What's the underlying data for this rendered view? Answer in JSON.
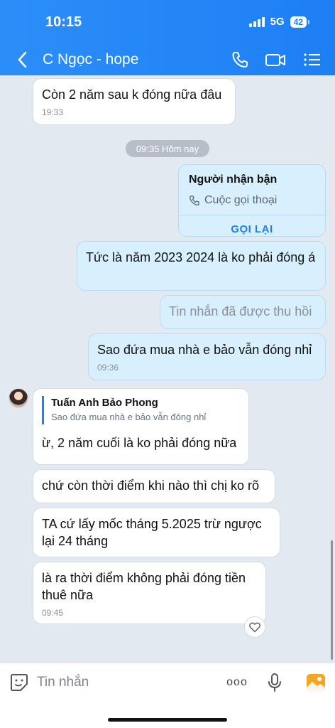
{
  "status_bar": {
    "time": "10:15",
    "network": "5G",
    "battery": "42"
  },
  "header": {
    "title": "C Ngọc - hope"
  },
  "messages": {
    "m1": {
      "text": "Còn 2 năm sau k đóng nữa đâu",
      "time": "19:33"
    },
    "date_separator": "09:35 Hôm nay",
    "call": {
      "who": "Người nhận bận",
      "type": "Cuộc gọi thoại",
      "action": "GỌI LẠI"
    },
    "m2": {
      "text": "Tức là năm 2023 2024 là ko phải đóng á"
    },
    "m3": {
      "text": "Tin nhắn đã được thu hồi"
    },
    "m4": {
      "text": "Sao đứa mua nhà e bảo vẫn đóng nhỉ",
      "time": "09:36"
    },
    "m5": {
      "quote_name": "Tuấn Anh Bảo Phong",
      "quote_text": "Sao đứa mua nhà e bảo vẫn đóng nhỉ",
      "text": "ừ, 2 năm cuối là ko phải đóng nữa"
    },
    "m6": {
      "text": "chứ còn thời điểm khi nào thì chị ko rõ"
    },
    "m7": {
      "text": "TA cứ lấy mốc tháng 5.2025 trừ ngược lại 24 tháng"
    },
    "m8": {
      "text": "là ra thời điểm không phải đóng tiền thuê nữa",
      "time": "09:45"
    }
  },
  "input": {
    "placeholder": "Tin nhắn",
    "more_label": "ooo"
  }
}
